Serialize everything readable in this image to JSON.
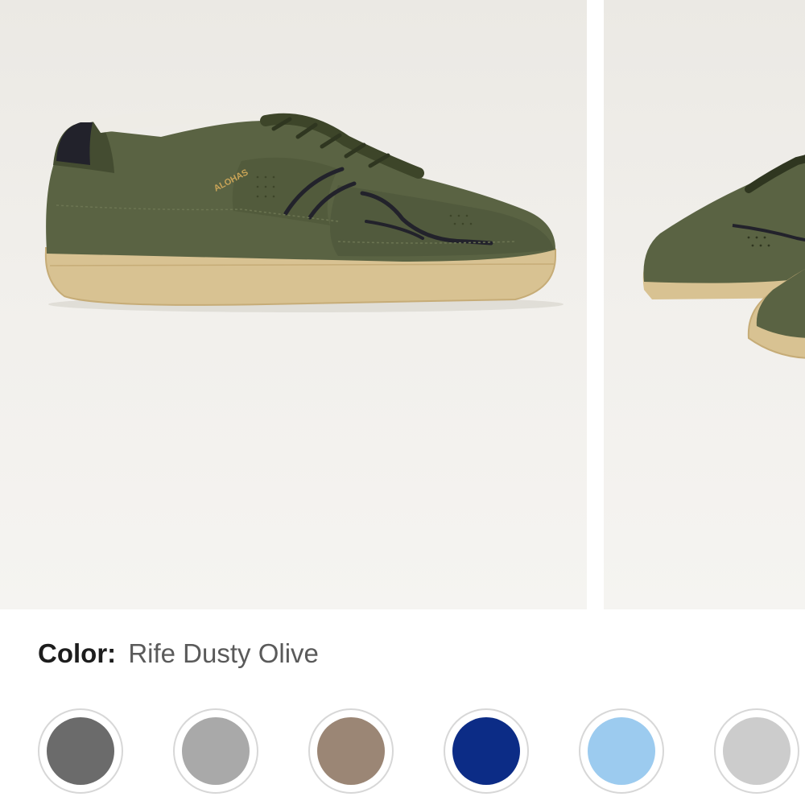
{
  "gallery": {
    "images": [
      {
        "alt": ""
      },
      {
        "alt": ""
      }
    ],
    "logo_text": "ALOHAS"
  },
  "color": {
    "label": "Color:",
    "value": "Rife Dusty Olive"
  },
  "swatches": [
    {
      "color": "#6b6b6b"
    },
    {
      "color": "#a9a9a9"
    },
    {
      "color": "#9b8675"
    },
    {
      "color": "#0c2c86"
    },
    {
      "color": "#9ccbef"
    },
    {
      "color": "#cccccc"
    }
  ],
  "palette": {
    "suede": "#5a6343",
    "suede_dark": "#444c31",
    "sole": "#d8c292",
    "sole_edge": "#c6ac77",
    "trim": "#22222b",
    "logo": "#c9a457"
  }
}
